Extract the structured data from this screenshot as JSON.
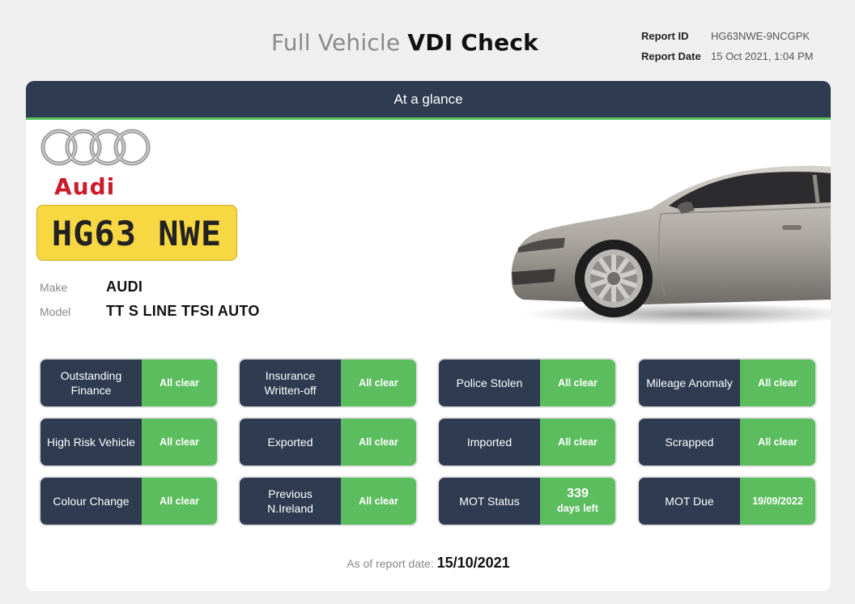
{
  "header": {
    "title_light": "Full Vehicle",
    "title_bold": "VDI Check",
    "report_id_label": "Report ID",
    "report_id": "HG63NWE-9NCGPK",
    "report_date_label": "Report Date",
    "report_date": "15 Oct 2021, 1:04 PM"
  },
  "card": {
    "section_title": "At a glance",
    "brand_word": "Audi",
    "plate": "HG63 NWE",
    "make_label": "Make",
    "make": "AUDI",
    "model_label": "Model",
    "model": "TT S LINE TFSI AUTO"
  },
  "checks": [
    {
      "label": "Outstanding Finance",
      "status": "All clear"
    },
    {
      "label": "Insurance Written-off",
      "status": "All clear"
    },
    {
      "label": "Police Stolen",
      "status": "All clear"
    },
    {
      "label": "Mileage Anomaly",
      "status": "All clear"
    },
    {
      "label": "High Risk Vehicle",
      "status": "All clear"
    },
    {
      "label": "Exported",
      "status": "All clear"
    },
    {
      "label": "Imported",
      "status": "All clear"
    },
    {
      "label": "Scrapped",
      "status": "All clear"
    },
    {
      "label": "Colour Change",
      "status": "All clear"
    },
    {
      "label": "Previous N.Ireland",
      "status": "All clear"
    },
    {
      "label": "MOT Status",
      "status_big": "339",
      "status_small": "days left"
    },
    {
      "label": "MOT Due",
      "status": "19/09/2022"
    }
  ],
  "footer": {
    "label": "As of report date:",
    "date": "15/10/2021"
  },
  "colors": {
    "navy": "#2e3b50",
    "green": "#5cbd5f",
    "plate_yellow": "#f7d843",
    "audi_red": "#cc1b2a"
  }
}
